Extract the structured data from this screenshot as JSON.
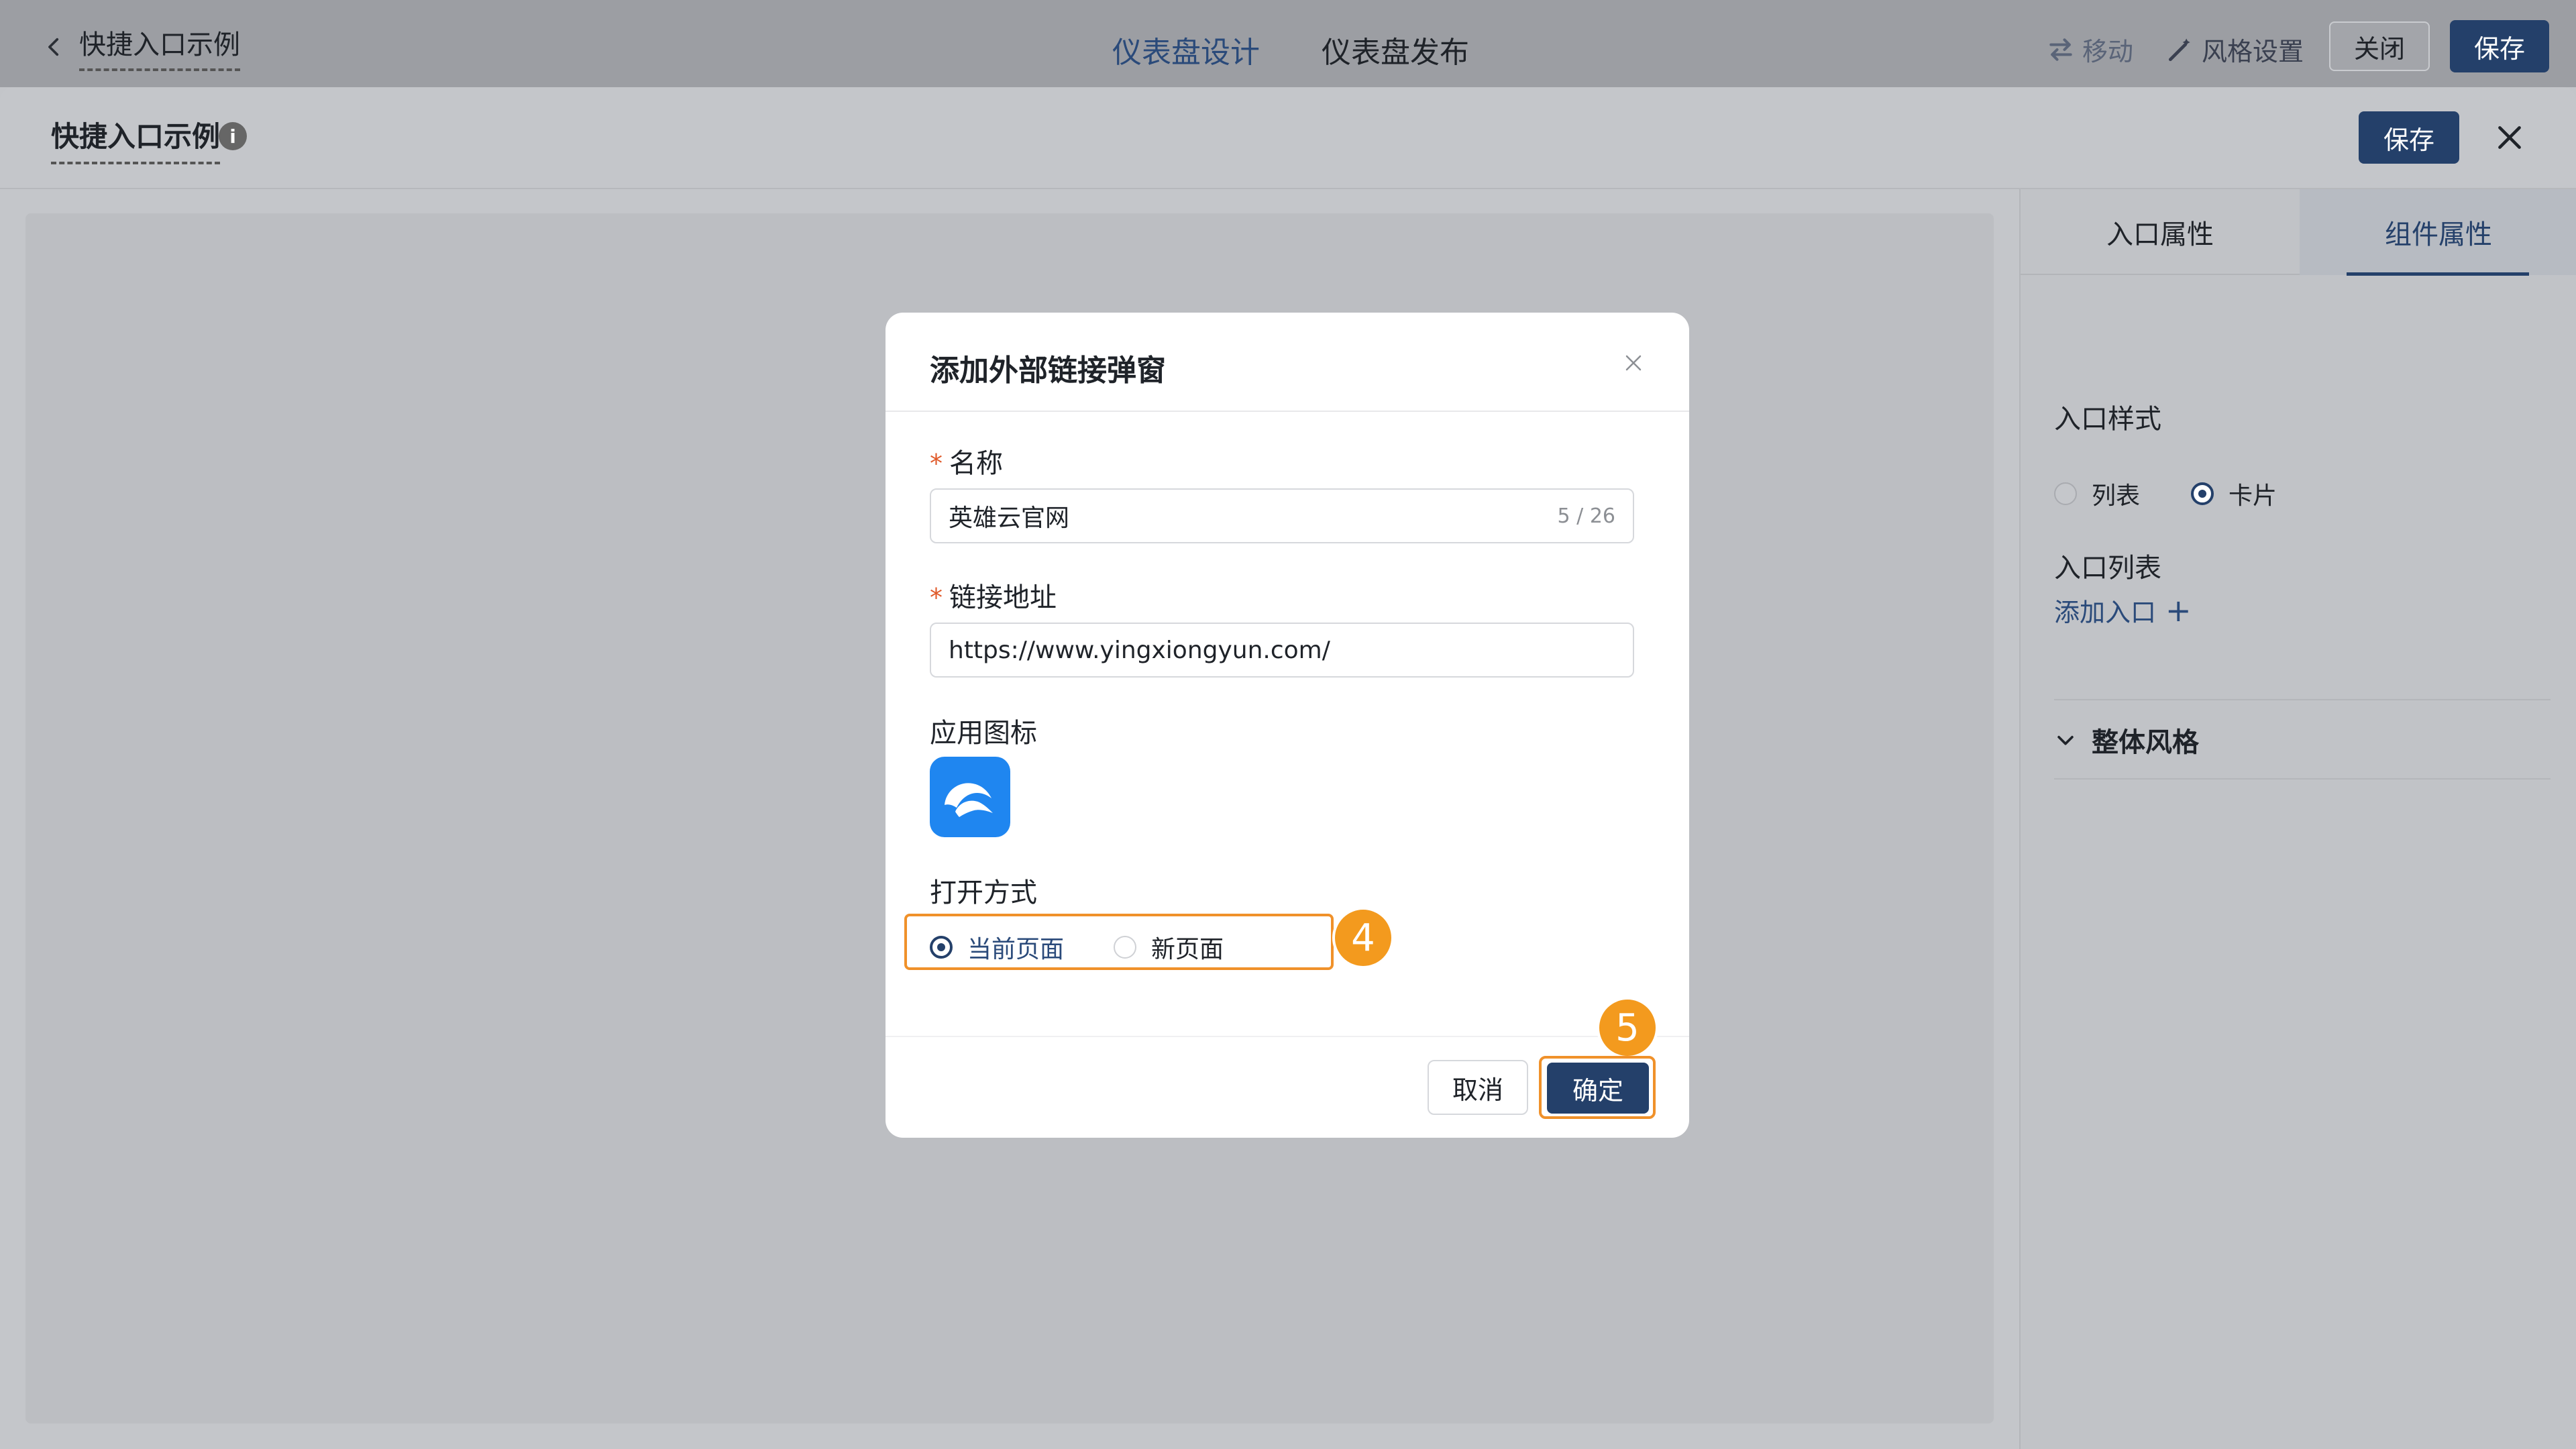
{
  "topbar": {
    "back_title": "快捷入口示例",
    "tabs": [
      "仪表盘设计",
      "仪表盘发布"
    ],
    "move_label": "移动",
    "style_label": "风格设置",
    "close_label": "关闭",
    "save_label": "保存"
  },
  "sheet": {
    "title": "快捷入口示例",
    "info_glyph": "i",
    "save_label": "保存"
  },
  "right_panel": {
    "tabs": [
      "入口属性",
      "组件属性"
    ],
    "active_tab": "组件属性",
    "entry_style_label": "入口样式",
    "style_options": [
      "列表",
      "卡片"
    ],
    "style_selected": "卡片",
    "entry_list_label": "入口列表",
    "add_entry_label": "添加入口",
    "add_glyph": "+",
    "overall_style_label": "整体风格"
  },
  "modal": {
    "title": "添加外部链接弹窗",
    "name_label": "名称",
    "name_value": "英雄云官网",
    "name_count": "5 / 26",
    "url_label": "链接地址",
    "url_value": "https://www.yingxiongyun.com/",
    "icon_label": "应用图标",
    "open_mode_label": "打开方式",
    "open_options": [
      "当前页面",
      "新页面"
    ],
    "open_selected": "当前页面",
    "required_mark": "*",
    "cancel_label": "取消",
    "ok_label": "确定"
  },
  "annotations": {
    "step_a": "4",
    "step_b": "5"
  },
  "colors": {
    "primary": "#24406a",
    "highlight": "#f0912a",
    "badge": "#f39a1e",
    "app_icon": "#1f86f0"
  }
}
